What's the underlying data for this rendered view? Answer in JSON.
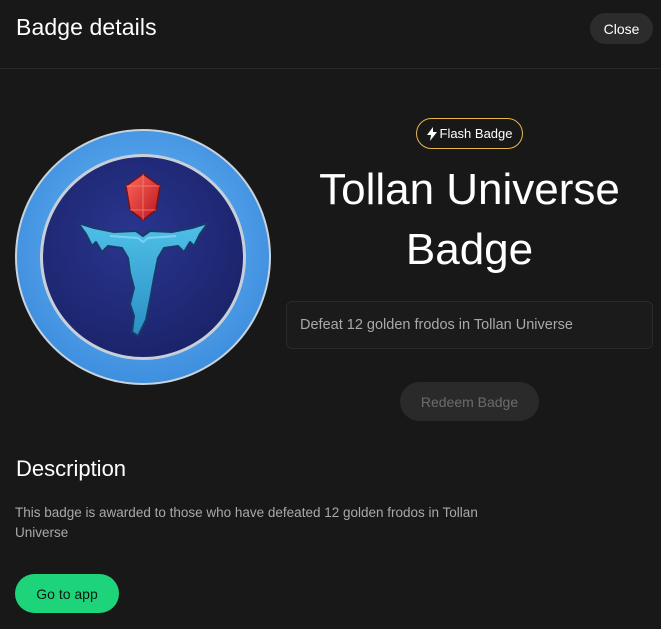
{
  "header": {
    "title": "Badge details",
    "close_label": "Close"
  },
  "badge": {
    "tag_label": "Flash Badge",
    "tag_icon": "lightning-icon",
    "title": "Tollan Universe Badge",
    "task": "Defeat 12 golden frodos in Tollan Universe",
    "redeem_label": "Redeem Badge",
    "image_icon": "tollan-t-emblem-icon"
  },
  "description": {
    "heading": "Description",
    "text": "This badge is awarded to those who have defeated 12 golden frodos in Tollan Universe"
  },
  "actions": {
    "go_to_app_label": "Go to app"
  },
  "colors": {
    "background": "#181818",
    "accent_green": "#1ed47a",
    "tag_border": "#e8b84a",
    "badge_ring": "#5aa8ec",
    "badge_inner": "#1e2a7a",
    "badge_symbol": "#3aa9d8",
    "gem": "#e03a3a"
  }
}
